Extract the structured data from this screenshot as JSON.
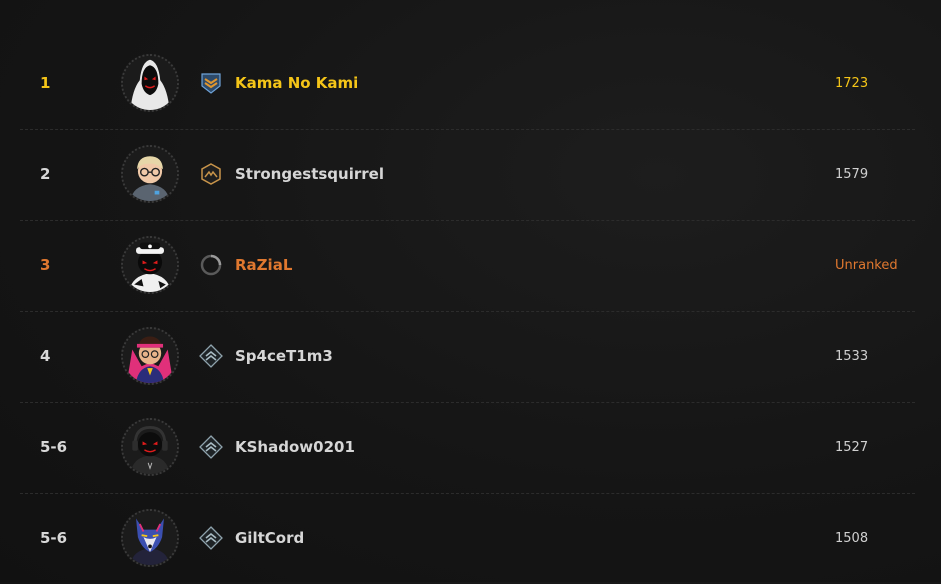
{
  "colors": {
    "gold": "#f5c518",
    "orange": "#e0782f",
    "text": "#d6d6d6",
    "background": "#151515"
  },
  "leaderboard": [
    {
      "rank": "1",
      "name": "Kama No Kami",
      "score": "1723",
      "badge": "chevron-rank-badge-icon",
      "avatar": "hooded-avatar",
      "highlight": "gold"
    },
    {
      "rank": "2",
      "name": "Strongestsquirrel",
      "score": "1579",
      "badge": "hexagon-mountain-badge-icon",
      "avatar": "glasses-avatar",
      "highlight": "none"
    },
    {
      "rank": "3",
      "name": "RaZiaL",
      "score": "Unranked",
      "badge": "unranked-ring-icon",
      "avatar": "hat-avatar",
      "highlight": "orange"
    },
    {
      "rank": "4",
      "name": "Sp4ceT1m3",
      "score": "1533",
      "badge": "diamond-chevron-badge-icon",
      "avatar": "cape-avatar",
      "highlight": "none"
    },
    {
      "rank": "5-6",
      "name": "KShadow0201",
      "score": "1527",
      "badge": "diamond-chevron-badge-icon",
      "avatar": "headphones-avatar",
      "highlight": "none"
    },
    {
      "rank": "5-6",
      "name": "GiltCord",
      "score": "1508",
      "badge": "diamond-chevron-badge-icon",
      "avatar": "wolf-avatar",
      "highlight": "none"
    }
  ]
}
